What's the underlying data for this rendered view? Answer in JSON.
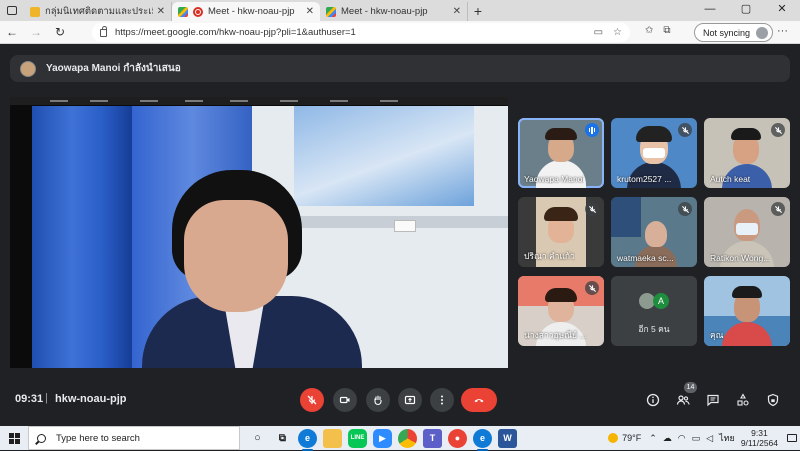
{
  "browser": {
    "tabs": [
      {
        "label": "กลุ่มนิเทศติดตามและประเมินผล - ระ",
        "active": false
      },
      {
        "label": "Meet - hkw-noau-pjp",
        "active": true
      },
      {
        "label": "Meet - hkw-noau-pjp",
        "active": false
      }
    ],
    "new_tab": "+",
    "window_controls": {
      "minimize": "—",
      "maximize": "▢",
      "close": "✕"
    },
    "url": "https://meet.google.com/hkw-noau-pjp?pli=1&authuser=1",
    "sync_label": "Not syncing",
    "more": "···"
  },
  "meet": {
    "presenting_banner": "Yaowapa Manoi กำลังนำเสนอ",
    "meeting_time": "09:31",
    "separator": "|",
    "meeting_code": "hkw-noau-pjp",
    "participant_count": "14",
    "tiles": [
      {
        "name": "Yaowapa Manoi",
        "speaking": true
      },
      {
        "name": "krutom2527 ...",
        "speaking": false
      },
      {
        "name": "Autch keat",
        "speaking": false
      },
      {
        "name": "ปริณา คำแก้ว",
        "speaking": false
      },
      {
        "name": "watmaeka sc...",
        "speaking": false
      },
      {
        "name": "Ratikon Wong...",
        "speaking": false
      },
      {
        "name": "นางสาวอุษณีย์ ...",
        "speaking": false
      },
      {
        "name": "อีก 5 คน",
        "more_avatar_letter": "A"
      },
      {
        "name": "คุณ",
        "speaking": false
      }
    ],
    "colors": {
      "accent": "#8ab4f8",
      "danger": "#ea4335",
      "background": "#202124",
      "surface": "#3c4043"
    }
  },
  "taskbar": {
    "search_placeholder": "Type here to search",
    "weather": "79°F",
    "language": "ไทย",
    "time": "9:31",
    "date": "9/11/2564"
  }
}
